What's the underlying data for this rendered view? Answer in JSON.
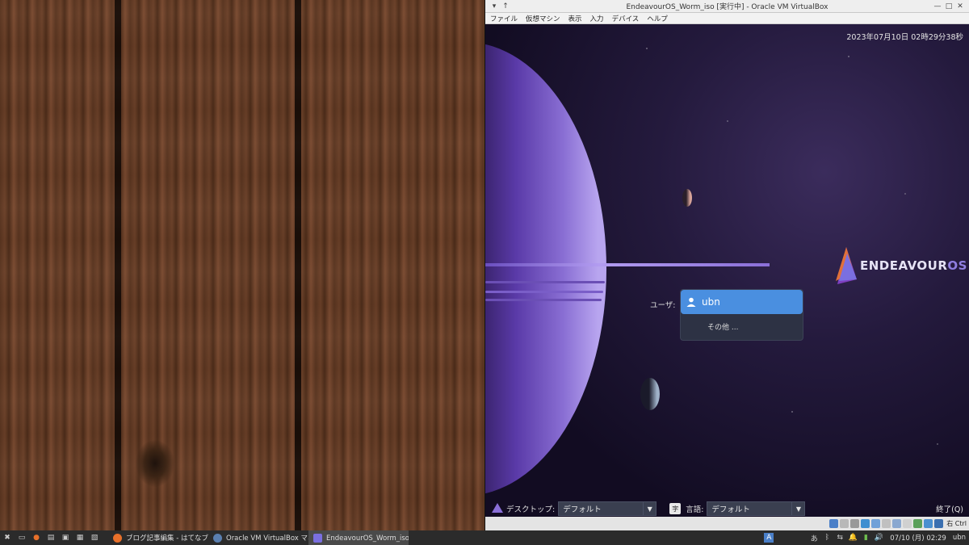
{
  "window": {
    "title": "EndeavourOS_Worm_iso [実行中] - Oracle VM VirtualBox",
    "menu": [
      "ファイル",
      "仮想マシン",
      "表示",
      "入力",
      "デバイス",
      "ヘルプ"
    ]
  },
  "greeter": {
    "clock": "2023年07月10日 02時29分38秒",
    "logo_main": "ENDEAVOUR",
    "logo_os": "OS",
    "user_label": "ユーザ:",
    "selected_user": "ubn",
    "other_user": "その他 ...",
    "desktop_label": "デスクトップ:",
    "desktop_value": "デフォルト",
    "language_label": "言語:",
    "language_value": "デフォルト",
    "quit_label": "終了(Q)"
  },
  "vm_status": {
    "host_key": "右 Ctrl"
  },
  "taskbar": {
    "tasks": [
      {
        "label": "ブログ記事編集 - はてなブロ...",
        "active": false
      },
      {
        "label": "Oracle VM VirtualBox マネー...",
        "active": false
      },
      {
        "label": "EndeavourOS_Worm_iso [実...",
        "active": true
      }
    ],
    "clock": "07/10 (月) 02:29",
    "user": "ubn"
  },
  "colors": {
    "accent": "#4a8fe0",
    "logo_purple": "#8f7ee0"
  }
}
